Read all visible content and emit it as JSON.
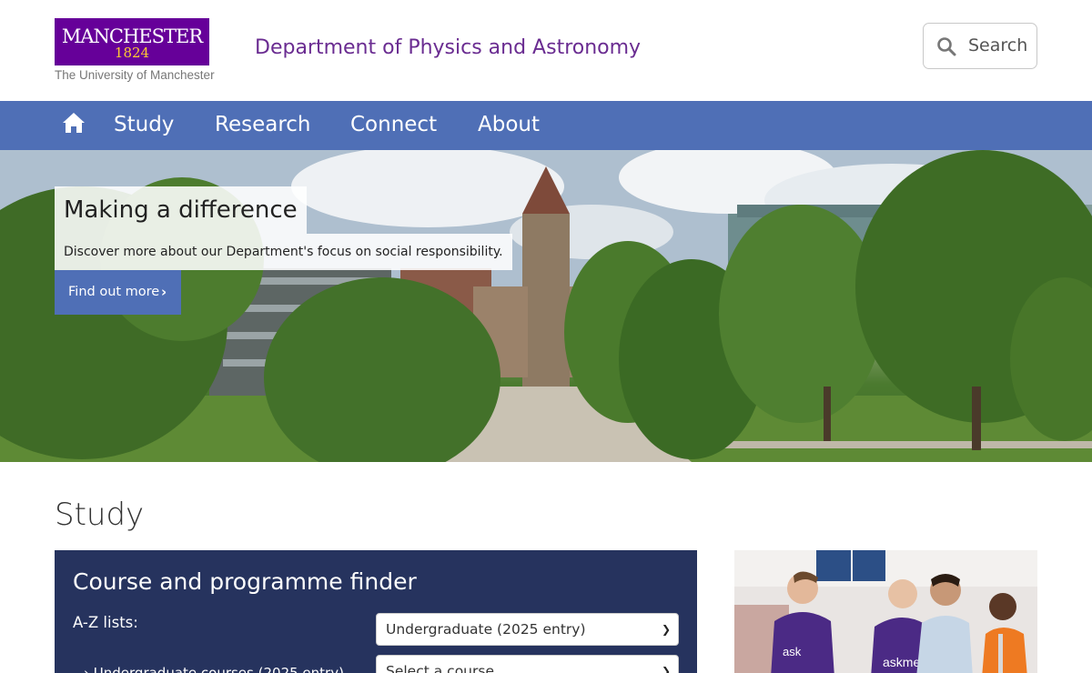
{
  "header": {
    "logo": {
      "wordmark": "MANCHESTER",
      "year": "1824",
      "subtitle": "The University of Manchester",
      "brand_color": "#660099",
      "year_color": "#ffcc33"
    },
    "department_title": "Department of Physics and Astronomy",
    "search": {
      "label": "Search",
      "icon": "search-icon"
    }
  },
  "nav": {
    "home_icon": "home-icon",
    "items": [
      {
        "label": "Study"
      },
      {
        "label": "Research"
      },
      {
        "label": "Connect"
      },
      {
        "label": "About"
      }
    ],
    "background": "#4f6fb6"
  },
  "hero": {
    "title": "Making a difference",
    "description": "Discover more about our Department's focus on social responsibility.",
    "cta_label": "Find out more",
    "cta_icon": "chevron-right-icon"
  },
  "study": {
    "heading": "Study",
    "finder": {
      "title": "Course and programme finder",
      "az_label": "A-Z lists:",
      "list_select_value": "Undergraduate (2025 entry)",
      "course_select_value": "Select a course",
      "first_link": "Undergraduate courses (2025 entry)",
      "background": "#26335e"
    }
  }
}
